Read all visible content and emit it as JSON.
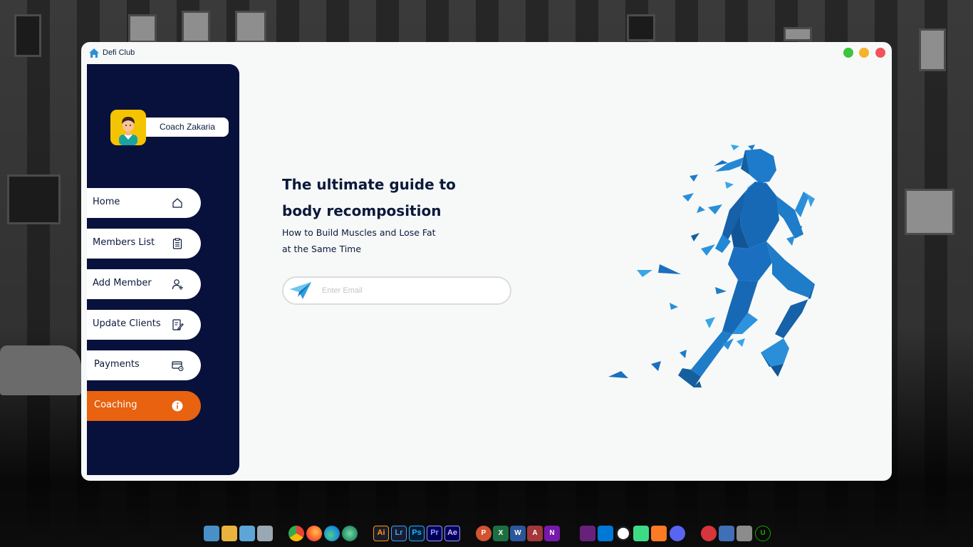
{
  "app": {
    "title": "Defi Club",
    "window_controls": {
      "maximize_color": "#3cc43c",
      "minimize_color": "#f5b32a",
      "close_color": "#f2545b"
    }
  },
  "sidebar": {
    "coach_name": "Coach Zakaria",
    "background_color": "#07113c",
    "accent_color": "#e8620f",
    "items": [
      {
        "label": "Home",
        "icon": "home-icon",
        "active": false
      },
      {
        "label": "Members List",
        "icon": "clipboard-list-icon",
        "active": false
      },
      {
        "label": "Add Member",
        "icon": "add-user-icon",
        "active": false
      },
      {
        "label": "Update Clients",
        "icon": "edit-document-icon",
        "active": false
      },
      {
        "label": "Payments",
        "icon": "payment-card-icon",
        "active": false
      },
      {
        "label": "Coaching",
        "icon": "info-icon",
        "active": true
      }
    ]
  },
  "main": {
    "headline_line1": "The ultimate guide to",
    "headline_line2": "body recomposition",
    "subtitle_line1": "How to Build Muscles and Lose Fat",
    "subtitle_line2": "at the Same Time",
    "email_placeholder": "Enter Email",
    "email_icon": "paper-plane-icon",
    "illustration": "low-poly-running-woman",
    "illustration_color": "#1a6fc0"
  },
  "taskbar": {
    "apps": [
      {
        "name": "this-pc-icon",
        "text": ""
      },
      {
        "name": "user-folder-icon",
        "text": ""
      },
      {
        "name": "control-panel-icon",
        "text": ""
      },
      {
        "name": "recycle-bin-icon",
        "text": ""
      },
      {
        "name": "chrome-icon",
        "text": ""
      },
      {
        "name": "firefox-icon",
        "text": ""
      },
      {
        "name": "edge-icon",
        "text": ""
      },
      {
        "name": "edge-dev-icon",
        "text": ""
      },
      {
        "name": "illustrator-icon",
        "text": "Ai"
      },
      {
        "name": "lightroom-icon",
        "text": "Lr"
      },
      {
        "name": "photoshop-icon",
        "text": "Ps"
      },
      {
        "name": "premiere-icon",
        "text": "Pr"
      },
      {
        "name": "after-effects-icon",
        "text": "Ae"
      },
      {
        "name": "powerpoint-icon",
        "text": "P"
      },
      {
        "name": "excel-icon",
        "text": "X"
      },
      {
        "name": "word-icon",
        "text": "W"
      },
      {
        "name": "access-icon",
        "text": "A"
      },
      {
        "name": "onenote-icon",
        "text": "N"
      },
      {
        "name": "visual-studio-icon",
        "text": ""
      },
      {
        "name": "vscode-icon",
        "text": ""
      },
      {
        "name": "webstorm-icon",
        "text": ""
      },
      {
        "name": "android-studio-icon",
        "text": ""
      },
      {
        "name": "xampp-icon",
        "text": ""
      },
      {
        "name": "discord-icon",
        "text": ""
      },
      {
        "name": "ccleaner-icon",
        "text": ""
      },
      {
        "name": "virtualbox-icon",
        "text": ""
      },
      {
        "name": "winrar-icon",
        "text": ""
      },
      {
        "name": "upwork-icon",
        "text": "U"
      }
    ]
  }
}
